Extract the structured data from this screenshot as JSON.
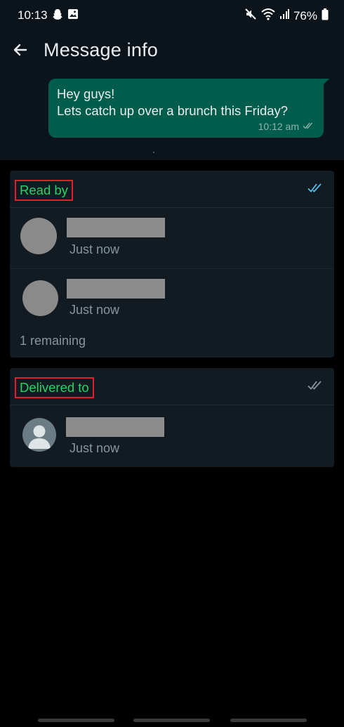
{
  "status_bar": {
    "time": "10:13",
    "battery": "76%",
    "icons": [
      "snapchat-icon",
      "image-icon",
      "mute-icon",
      "wifi-icon",
      "signal-icon",
      "battery-icon"
    ]
  },
  "header": {
    "title": "Message info",
    "back_icon": "arrow-left-icon"
  },
  "message": {
    "lines": [
      "Hey guys!",
      "Lets catch up over a brunch this Friday?"
    ],
    "time": "10:12 am",
    "status_icon": "double-check-icon"
  },
  "read_by": {
    "label": "Read by",
    "tick_color": "#53bdeb",
    "contacts": [
      {
        "time": "Just now"
      },
      {
        "time": "Just now"
      }
    ],
    "remaining": "1 remaining"
  },
  "delivered_to": {
    "label": "Delivered to",
    "tick_color": "#8696a0",
    "contacts": [
      {
        "time": "Just now"
      }
    ]
  },
  "colors": {
    "accent_green": "#25d366",
    "bubble": "#005c4b",
    "highlight_box": "#e0202d",
    "background": "#000000",
    "card": "#111b21"
  }
}
